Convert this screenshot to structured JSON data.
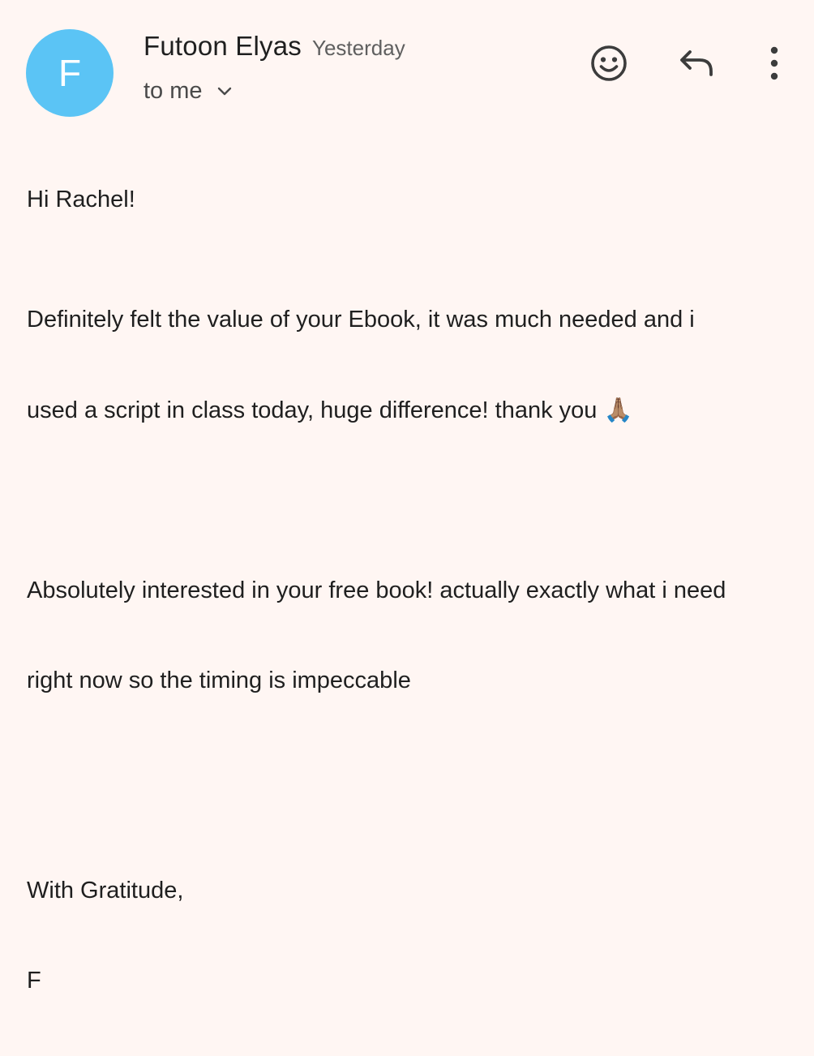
{
  "message": {
    "avatar_letter": "F",
    "avatar_color": "#5bc4f5",
    "sender_name": "Futoon Elyas",
    "time": "Yesterday",
    "recipient": "to me",
    "actions": {
      "emoji_icon": "emoji-reaction-icon",
      "reply_icon": "reply-icon",
      "more_icon": "more-vert-icon"
    },
    "body": {
      "greeting": "Hi Rachel!",
      "paragraph_1_line_1": "Definitely felt the value of your Ebook, it was much needed and i",
      "paragraph_1_line_2": "used a script in class today, huge difference! thank you",
      "paragraph_1_emoji": "🙏🏽",
      "paragraph_2_line_1": "Absolutely interested in your free book! actually exactly what i need",
      "paragraph_2_line_2": "right now so the timing is impeccable",
      "signoff": "With Gratitude,",
      "signature": "F"
    }
  }
}
